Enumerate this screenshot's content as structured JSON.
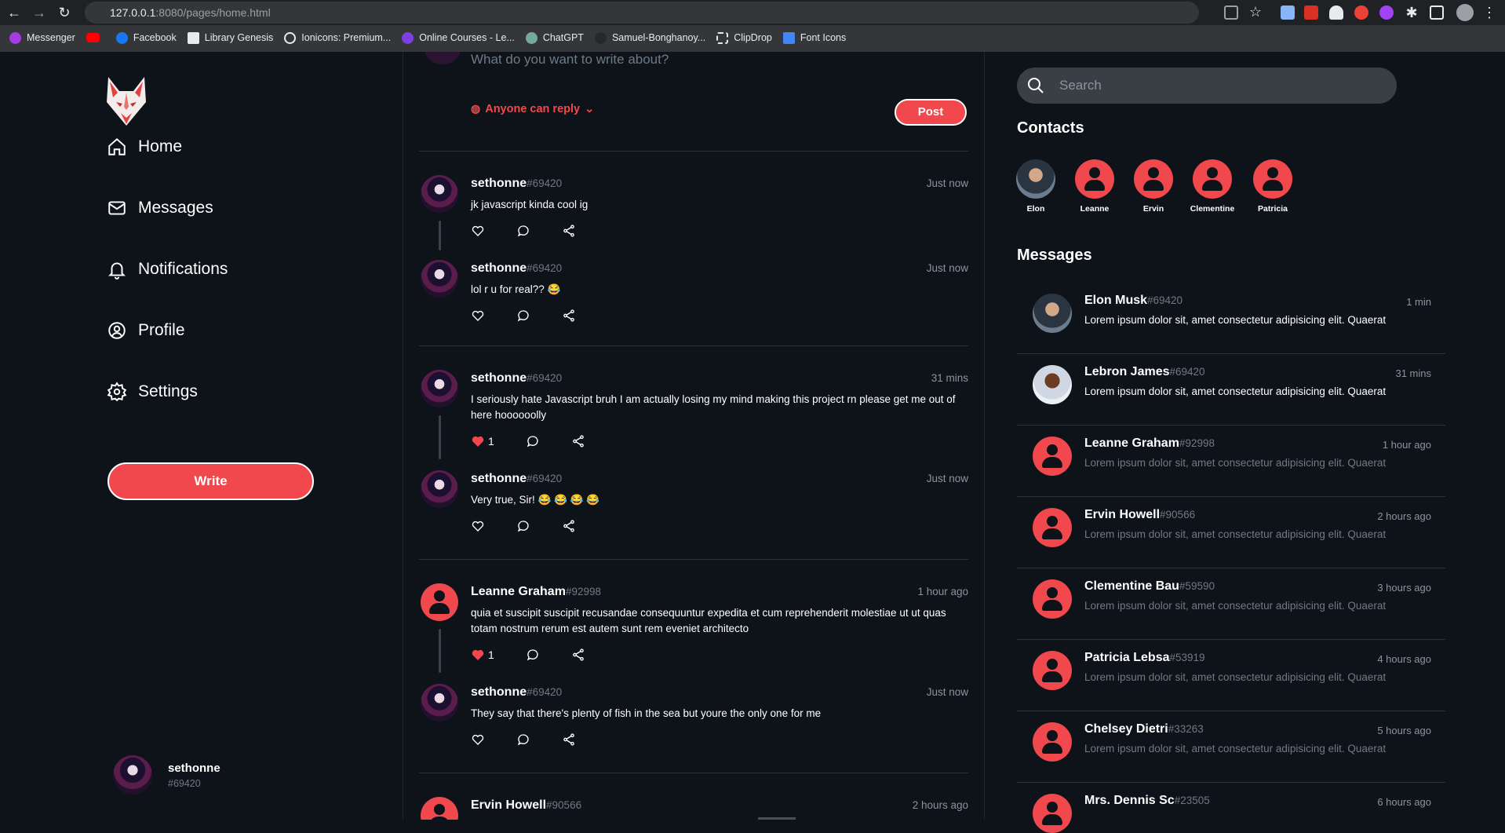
{
  "browser": {
    "url_host": "127.0.0.1",
    "url_path": ":8080/pages/home.html",
    "bookmarks": [
      "Messenger",
      "",
      "Facebook",
      "Library Genesis",
      "Ionicons: Premium...",
      "Online Courses - Le...",
      "ChatGPT",
      "Samuel-Bonghanoy...",
      "ClipDrop",
      "Font Icons"
    ]
  },
  "sidebar": {
    "nav": [
      {
        "label": "Home",
        "icon": "home-icon"
      },
      {
        "label": "Messages",
        "icon": "mail-icon"
      },
      {
        "label": "Notifications",
        "icon": "bell-icon"
      },
      {
        "label": "Profile",
        "icon": "user-circle-icon"
      },
      {
        "label": "Settings",
        "icon": "gear-icon"
      }
    ],
    "write_label": "Write",
    "user": {
      "name": "sethonne",
      "tag": "#69420"
    }
  },
  "composer": {
    "placeholder": "What do you want to write about?",
    "reply_setting": "Anyone can reply",
    "post_label": "Post"
  },
  "feed": [
    {
      "name": "sethonne",
      "tag": "#69420",
      "time": "Just now",
      "text": "jk javascript kinda cool ig",
      "likes": "",
      "liked": false
    },
    {
      "name": "sethonne",
      "tag": "#69420",
      "time": "Just now",
      "text": "lol r u for real?? 😂",
      "likes": "",
      "liked": false
    },
    {
      "name": "sethonne",
      "tag": "#69420",
      "time": "31 mins",
      "text": "I seriously hate Javascript bruh I am actually losing my mind making this project rn please get me out of here hoooooolly",
      "likes": "1",
      "liked": true
    },
    {
      "name": "sethonne",
      "tag": "#69420",
      "time": "Just now",
      "text": "Very true, Sir! 😂 😂 😂 😂",
      "likes": "",
      "liked": false
    },
    {
      "name": "Leanne Graham",
      "tag": "#92998",
      "time": "1 hour ago",
      "text": "quia et suscipit suscipit recusandae consequuntur expedita et cum reprehenderit molestiae ut ut quas totam nostrum rerum est autem sunt rem eveniet architecto",
      "likes": "1",
      "liked": true
    },
    {
      "name": "sethonne",
      "tag": "#69420",
      "time": "Just now",
      "text": "They say that there's plenty of fish in the sea but youre the only one for me",
      "likes": "",
      "liked": false
    },
    {
      "name": "Ervin Howell",
      "tag": "#90566",
      "time": "2 hours ago",
      "text": "",
      "likes": "",
      "liked": false
    }
  ],
  "right": {
    "search_placeholder": "Search",
    "contacts_title": "Contacts",
    "contacts": [
      "Elon",
      "Leanne",
      "Ervin",
      "Clementine",
      "Patricia"
    ],
    "messages_title": "Messages",
    "messages": [
      {
        "name": "Elon Musk",
        "tag": "#69420",
        "time": "1 min",
        "text": "Lorem ipsum dolor sit, amet consectetur adipisicing elit. Quaerat",
        "unread": true
      },
      {
        "name": "Lebron James",
        "tag": "#69420",
        "time": "31 mins",
        "text": "Lorem ipsum dolor sit, amet consectetur adipisicing elit. Quaerat",
        "unread": true
      },
      {
        "name": "Leanne Graham",
        "tag": "#92998",
        "time": "1 hour ago",
        "text": "Lorem ipsum dolor sit, amet consectetur adipisicing elit. Quaerat",
        "unread": false
      },
      {
        "name": "Ervin Howell",
        "tag": "#90566",
        "time": "2 hours ago",
        "text": "Lorem ipsum dolor sit, amet consectetur adipisicing elit. Quaerat",
        "unread": false
      },
      {
        "name": "Clementine Bau",
        "tag": "#59590",
        "time": "3 hours ago",
        "text": "Lorem ipsum dolor sit, amet consectetur adipisicing elit. Quaerat",
        "unread": false
      },
      {
        "name": "Patricia Lebsa",
        "tag": "#53919",
        "time": "4 hours ago",
        "text": "Lorem ipsum dolor sit, amet consectetur adipisicing elit. Quaerat",
        "unread": false
      },
      {
        "name": "Chelsey Dietri",
        "tag": "#33263",
        "time": "5 hours ago",
        "text": "Lorem ipsum dolor sit, amet consectetur adipisicing elit. Quaerat",
        "unread": false
      },
      {
        "name": "Mrs. Dennis Sc",
        "tag": "#23505",
        "time": "6 hours ago",
        "text": "",
        "unread": false
      }
    ]
  },
  "colors": {
    "accent": "#f0484c",
    "background": "#0d1319",
    "muted": "#6f7a86"
  }
}
